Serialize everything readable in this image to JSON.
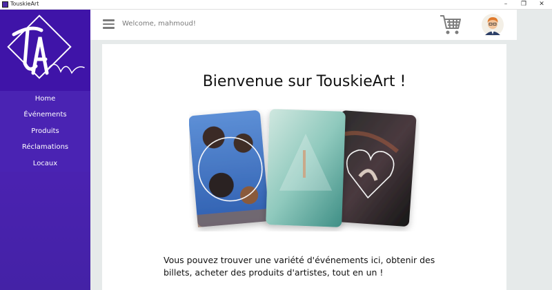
{
  "window": {
    "title": "TouskieArt",
    "controls": {
      "minimize": "–",
      "maximize": "❐",
      "close": "✕"
    }
  },
  "sidebar": {
    "logo_text": "TA",
    "items": [
      {
        "label": "Home"
      },
      {
        "label": "Événements"
      },
      {
        "label": "Produits"
      },
      {
        "label": "Réclamations"
      },
      {
        "label": "Locaux"
      }
    ]
  },
  "header": {
    "welcome": "Welcome, mahmoud!",
    "icons": {
      "menu": "hamburger-menu-icon",
      "cart": "shopping-cart-icon",
      "avatar": "user-avatar"
    }
  },
  "main": {
    "title": "Bienvenue sur TouskieArt !",
    "description": "Vous pouvez trouver une variété d'événements ici, obtenir des billets, acheter des produits d'artistes, tout en un !"
  },
  "colors": {
    "sidebar": "#4a22b0",
    "logo_bg": "#3f14a8",
    "background": "#e6eaea"
  }
}
